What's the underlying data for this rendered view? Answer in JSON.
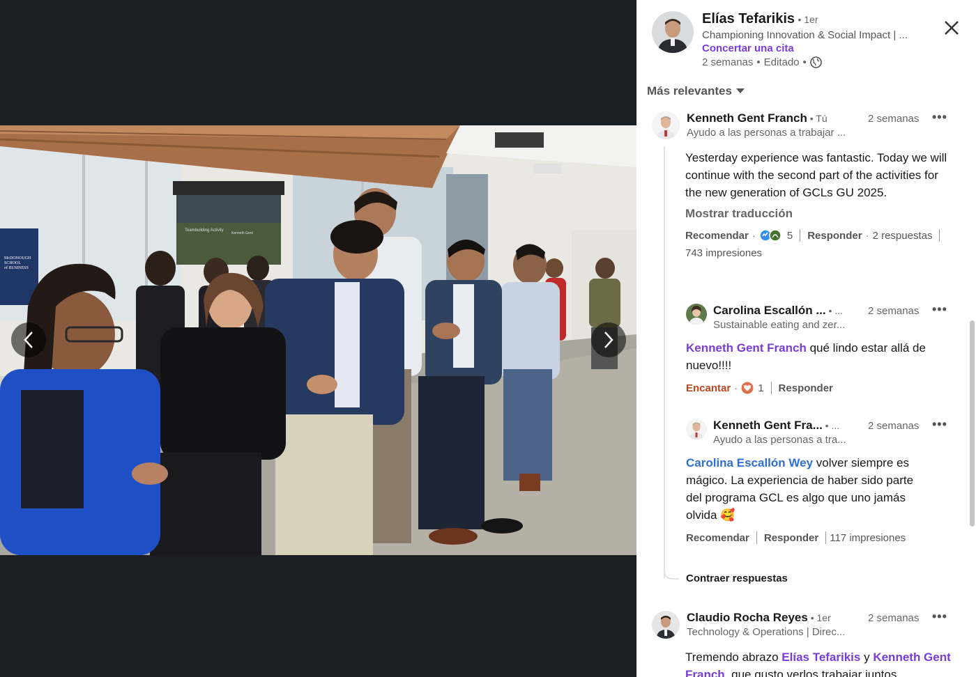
{
  "post_author": {
    "name": "Elías Tefarikis",
    "degree": "1er",
    "headline": "Championing Innovation & Social Impact | ...",
    "link_label": "Concertar una cita",
    "time": "2 semanas",
    "edited": "Editado",
    "visibility_icon": "globe-icon"
  },
  "sort": {
    "label": "Más relevantes"
  },
  "photo": {
    "poster": {
      "left_title": "Teambuilding Activity",
      "right_title": "Kenneth Gent"
    },
    "banner": {
      "lines": [
        "McDONOUGH",
        "SCHOOL",
        "of BUSINESS"
      ]
    }
  },
  "comments": [
    {
      "name": "Kenneth Gent Franch",
      "tag": "Tú",
      "headline": "Ayudo a las personas a trabajar ...",
      "time": "2 semanas",
      "more": "•••",
      "text": "Yesterday experience was fantastic. Today we will continue with the second part of the activities for the new generation of GCLs GU 2025.",
      "translate": "Mostrar traducción",
      "like_label": "Recomendar",
      "reaction_count": "5",
      "reply_label": "Responder",
      "replies_count": "2 respuestas",
      "impressions": "743 impresiones"
    }
  ],
  "replies": [
    {
      "name": "Carolina Escallón ...",
      "tag": "...",
      "headline": "Sustainable eating and zer...",
      "time": "2 semanas",
      "more": "•••",
      "mention": "Kenneth Gent Franch",
      "text": " qué lindo estar allá de nuevo!!!!",
      "like_label": "Encantar",
      "reaction_count": "1",
      "reply_label": "Responder"
    },
    {
      "name": "Kenneth Gent Fra...",
      "tag": "...",
      "headline": "Ayudo a las personas a tra...",
      "time": "2 semanas",
      "more": "•••",
      "mention": "Carolina Escallón Wey",
      "text": " volver siempre es mágico. La experiencia de haber sido parte del programa GCL es algo que uno jamás olvida 🥰",
      "like_label": "Recomendar",
      "reply_label": "Responder",
      "impressions": "117 impresiones"
    }
  ],
  "collapse_label": "Contraer respuestas",
  "next_comment": {
    "name": "Claudio Rocha Reyes",
    "tag": "1er",
    "headline": "Technology & Operations | Direc...",
    "time": "2 semanas",
    "more": "•••",
    "text_start": "Tremendo abrazo ",
    "mention1": "Elías Tefarikis",
    "joiner": " y ",
    "mention2": "Kenneth Gent Franch",
    "text_end": ", que gusto verlos trabajar juntos"
  },
  "colors": {
    "link_purple": "#7a3cd9",
    "mention_blue": "#2f6fd1",
    "love_red": "#c0451c",
    "backdrop": "#1b1f23"
  }
}
